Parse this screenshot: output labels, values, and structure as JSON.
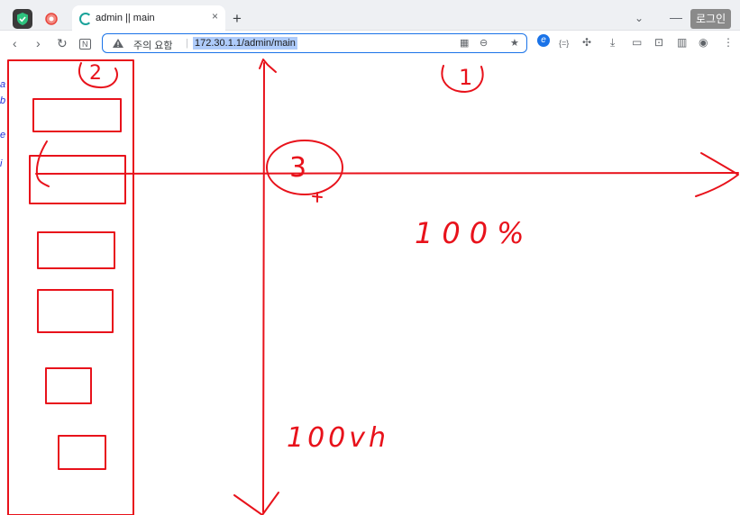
{
  "browser": {
    "tab_title": "admin || main",
    "tab_close": "×",
    "new_tab": "+",
    "tab_list": "⌄",
    "minimize": "—",
    "login_label": "로그인",
    "security_warning": "주의 요함",
    "url": "172.30.1.1/admin/main",
    "nav": {
      "back": "‹",
      "forward": "›",
      "reload": "↻",
      "note": "N"
    },
    "omnibox_icons": {
      "qr": "▦",
      "zoom": "⊖",
      "star": "★"
    },
    "toolbar_icons": {
      "edge": "e",
      "bracket": "{=}",
      "extensions": "✣",
      "download": "⤓",
      "cast": "▭",
      "screenshot": "⊡",
      "sidebar": "▥",
      "profile": "◉",
      "menu": "⋮"
    }
  },
  "page": {
    "left_edge_fragments": [
      "a",
      "b",
      "e",
      "i"
    ],
    "annotations": {
      "circle_1": "1",
      "circle_2": "2",
      "circle_3": "3",
      "width_note": "100%",
      "height_note": "100vh"
    }
  },
  "colors": {
    "annotation": "#e8121b",
    "accent": "#1a73e8",
    "spinner": "#1aa29a"
  }
}
